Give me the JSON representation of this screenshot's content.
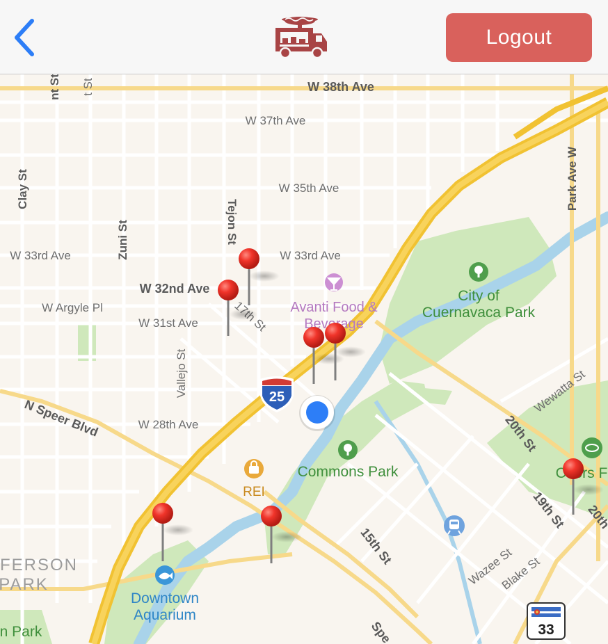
{
  "header": {
    "back_icon": "chevron-left-icon",
    "logo_icon": "food-truck-icon",
    "logout_label": "Logout",
    "accent_color": "#2d7ef7",
    "logout_color": "#d9615c",
    "logo_color": "#a84445"
  },
  "map": {
    "street_labels": [
      "W 38th Ave",
      "W 37th Ave",
      "W 35th Ave",
      "W 33rd Ave",
      "W 33rd Ave",
      "W 32nd Ave",
      "W Argyle Pl",
      "W 31st Ave",
      "W 28th Ave",
      "N Speer Blvd",
      "Clay St",
      "Zuni St",
      "Tejon St",
      "Vallejo St",
      "17th St",
      "Park Ave W",
      "20th St",
      "19th St",
      "15th St",
      "Wewatta St",
      "Wazee St",
      "Blake St",
      "20th",
      "Spe",
      "nt St",
      "t St"
    ],
    "place_labels": {
      "avanti": "Avanti Food &\nBeverage",
      "avanti_line1": "Avanti Food &",
      "avanti_line2": "Beverage",
      "cuernavaca_line1": "City of",
      "cuernavaca_line2": "Cuernavaca Park",
      "commons": "Commons Park",
      "rei": "REI",
      "aquarium_line1": "Downtown",
      "aquarium_line2": "Aquarium",
      "jefferson_line1": "FERSON",
      "jefferson_line2": "PARK",
      "coors": "Coors F",
      "npark": "n Park"
    },
    "shields": {
      "interstate": "25",
      "state_route": "33"
    },
    "icons": [
      "park-icon",
      "cocktail-icon",
      "shopping-bag-icon",
      "aquarium-icon",
      "train-icon",
      "stadium-icon",
      "user-location-icon",
      "map-pin-icon"
    ],
    "pin_count": 7
  }
}
